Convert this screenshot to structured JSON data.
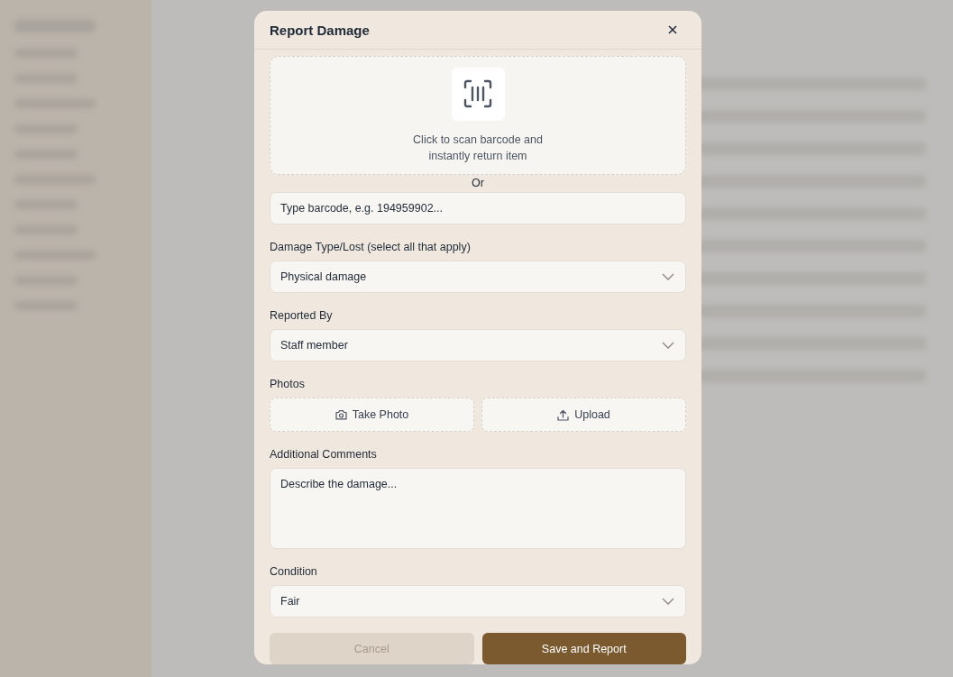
{
  "dialog": {
    "title": "Report Damage",
    "scan": {
      "text": "Click to scan barcode and instantly return item"
    },
    "separator": "Or",
    "barcode_field": {
      "placeholder": "Type barcode, e.g. 194959902..."
    },
    "fields": [
      {
        "kind": "select",
        "label": "Damage Type/Lost (select all that apply)",
        "value": "Physical damage"
      },
      {
        "kind": "select",
        "label": "Reported By",
        "value": "Staff member"
      },
      {
        "kind": "photos",
        "label": "Photos",
        "buttons": [
          "Take Photo",
          "Upload"
        ]
      },
      {
        "kind": "textarea",
        "label": "Additional Comments",
        "placeholder": "Describe the damage..."
      },
      {
        "kind": "select",
        "label": "Condition",
        "value": "Fair"
      }
    ],
    "actions": [
      {
        "kind": "secondary",
        "label": "Cancel"
      },
      {
        "kind": "primary",
        "label": "Save and Report"
      }
    ]
  }
}
